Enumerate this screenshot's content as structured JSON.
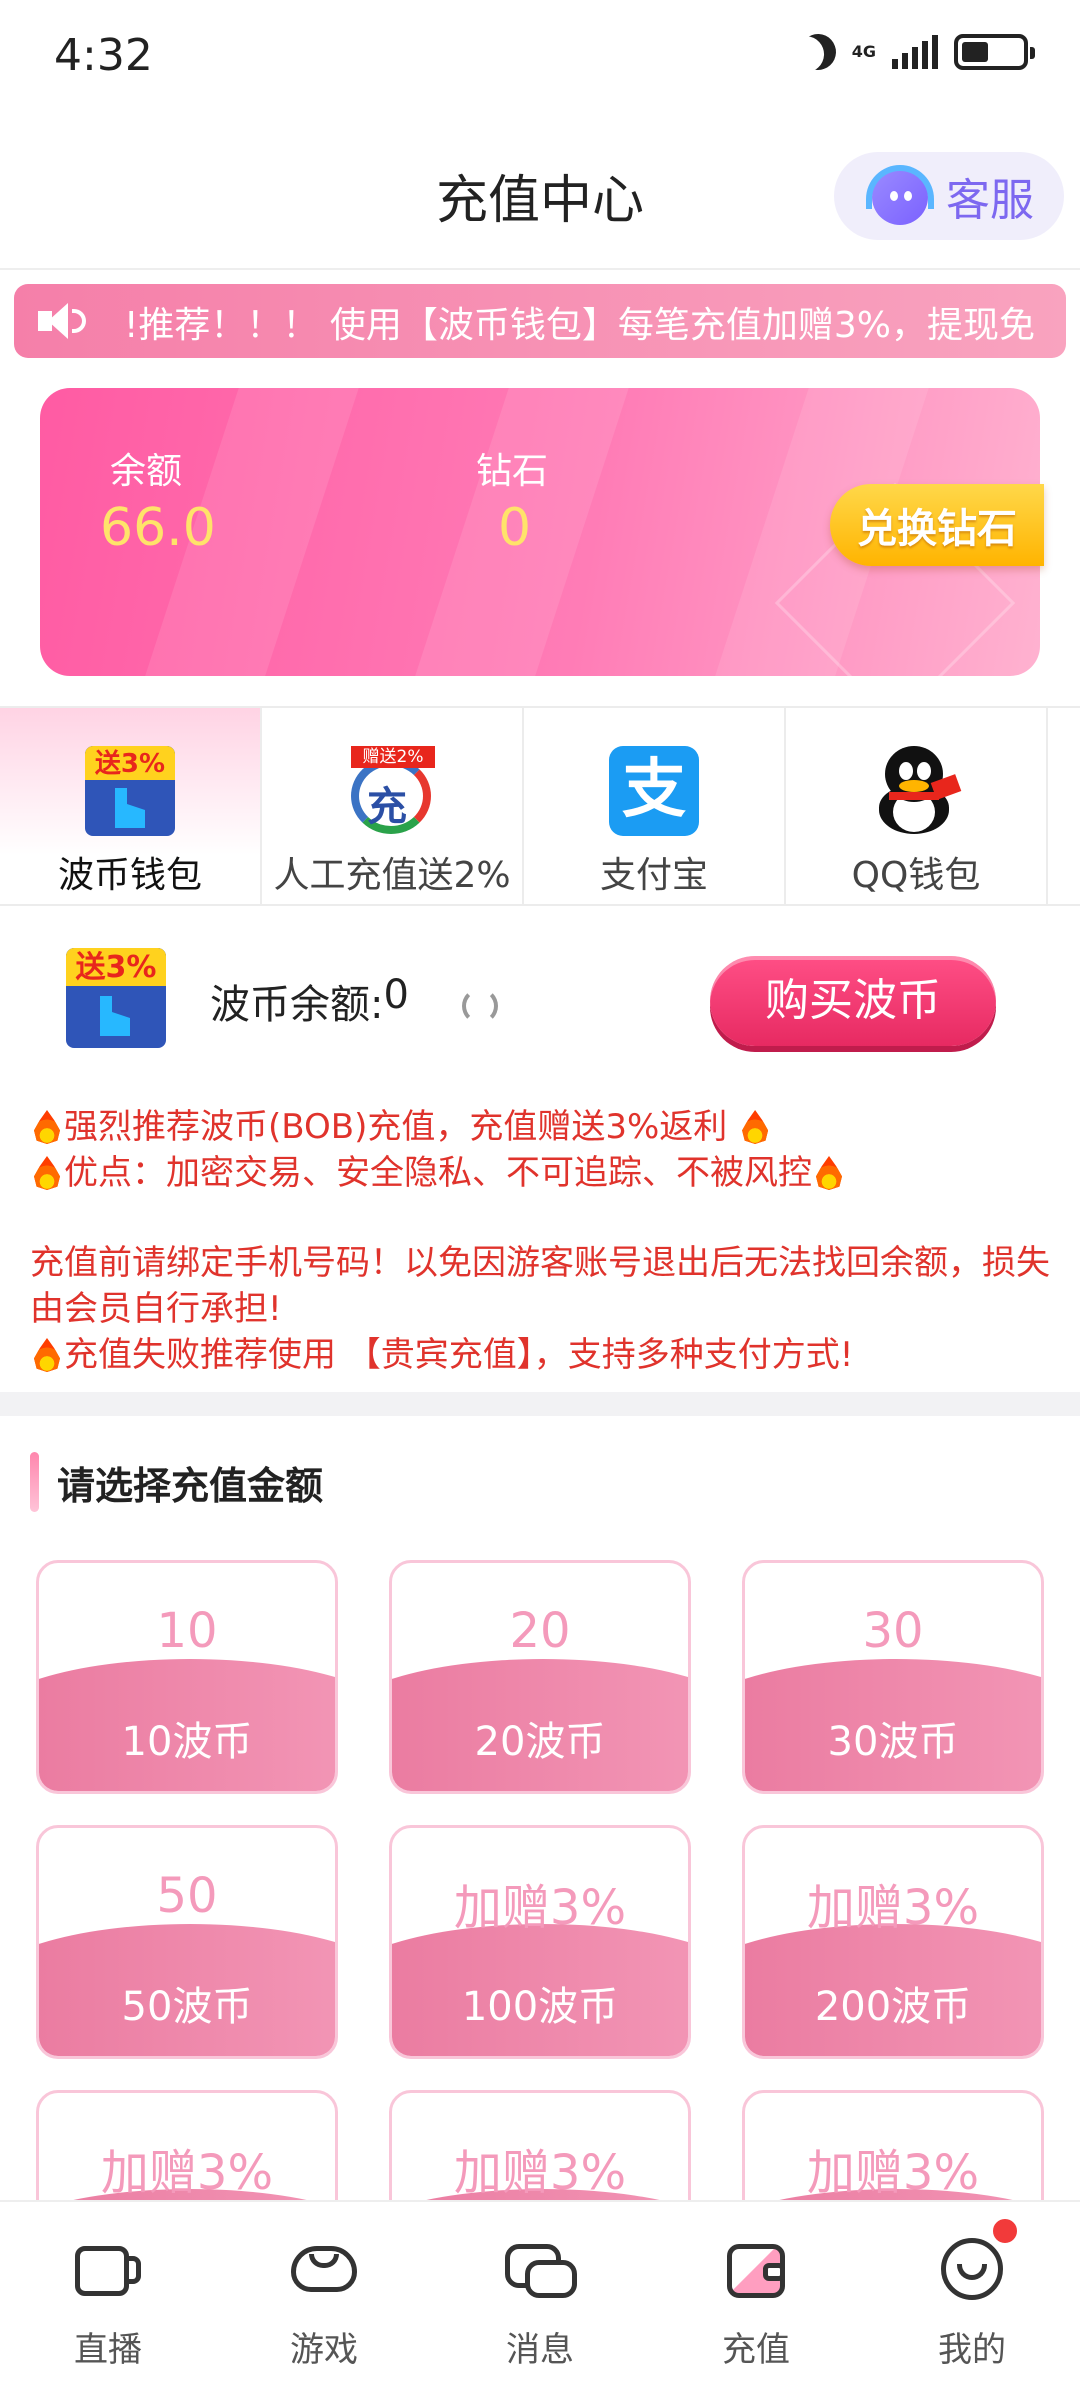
{
  "status_bar": {
    "time": "4:32",
    "network": "4G"
  },
  "header": {
    "title": "充值中心",
    "service_label": "客服"
  },
  "marquee": {
    "text": "!推荐！！！ 使用【波币钱包】每笔充值加赠3%，提现免"
  },
  "balance": {
    "balance_label": "余额",
    "balance_value": "66.0",
    "diamond_label": "钻石",
    "diamond_value": "0",
    "exchange_label": "兑换钻石"
  },
  "pay_tabs": [
    {
      "label": "波币钱包",
      "icon": "bob-wallet-icon",
      "badge": "送3%"
    },
    {
      "label": "人工充值送2%",
      "icon": "manual-recharge-icon",
      "badge": "赠送2%",
      "glyph": "充"
    },
    {
      "label": "支付宝",
      "icon": "alipay-icon",
      "glyph": "支"
    },
    {
      "label": "QQ钱包",
      "icon": "qq-wallet-icon"
    }
  ],
  "bob_row": {
    "badge": "送3%",
    "balance_label": "波币余额: ",
    "balance_value": "0",
    "buy_label": "购买波币"
  },
  "notes": {
    "line1": "强烈推荐波币(BOB)充值，充值赠送3%返利",
    "line2": "优点：加密交易、安全隐私、不可追踪、不被风控",
    "line3": "充值前请绑定手机号码！以免因游客账号退出后无法找回余额，损失由会员自行承担!",
    "line4": "充值失败推荐使用 【贵宾充值】，支持多种支付方式!"
  },
  "amount_section": {
    "title": "请选择充值金额",
    "items": [
      {
        "top": "10",
        "bottom": "10波币"
      },
      {
        "top": "20",
        "bottom": "20波币"
      },
      {
        "top": "30",
        "bottom": "30波币"
      },
      {
        "top": "50",
        "bottom": "50波币"
      },
      {
        "top": "加赠3%",
        "bottom": "100波币"
      },
      {
        "top": "加赠3%",
        "bottom": "200波币"
      },
      {
        "top": "加赠3%",
        "bottom": ""
      },
      {
        "top": "加赠3%",
        "bottom": ""
      },
      {
        "top": "加赠3%",
        "bottom": ""
      }
    ]
  },
  "bottom_nav": [
    {
      "label": "直播",
      "icon": "live-camera-icon"
    },
    {
      "label": "游戏",
      "icon": "gamepad-icon"
    },
    {
      "label": "消息",
      "icon": "message-icon"
    },
    {
      "label": "充值",
      "icon": "wallet-icon"
    },
    {
      "label": "我的",
      "icon": "profile-icon"
    }
  ],
  "colors": {
    "accent": "#ff5ba3",
    "alert": "#e0332c",
    "gold": "#ffe36a"
  }
}
